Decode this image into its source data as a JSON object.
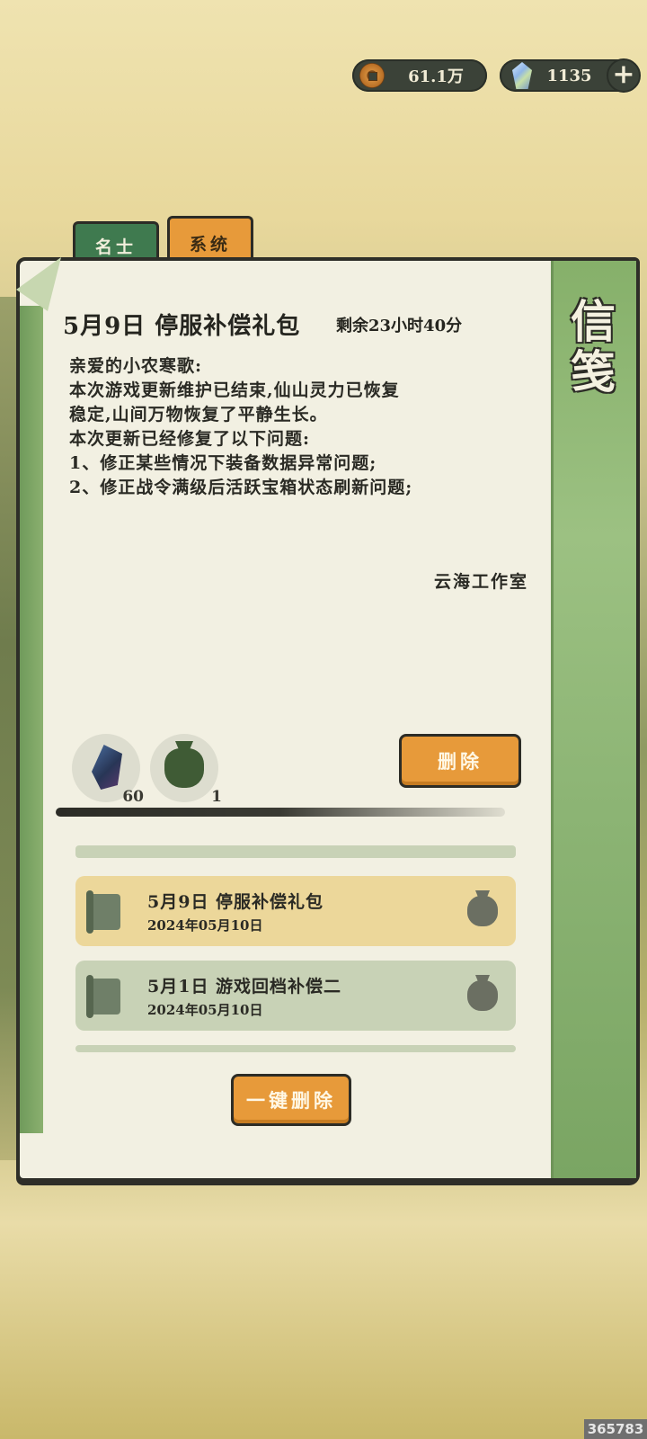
{
  "currency": {
    "coins": "61.1万",
    "gems": "1135",
    "plus": "+",
    "coin_icon": "copper-coin-icon",
    "gem_icon": "spirit-crystal-icon"
  },
  "tabs": [
    {
      "label": "名士",
      "active": false
    },
    {
      "label": "系统",
      "active": true
    }
  ],
  "panel": {
    "side_title": "信笺",
    "mail": {
      "title": "5月9日 停服补偿礼包",
      "remaining": "剩余23小时40分",
      "body": [
        "亲爱的小农寒歌:",
        "本次游戏更新维护已结束,仙山灵力已恢复",
        "稳定,山间万物恢复了平静生长。",
        "",
        "本次更新已经修复了以下问题:",
        "1、修正某些情况下装备数据异常问题;",
        "2、修正战令满级后活跃宝箱状态刷新问题;"
      ],
      "signature": "云海工作室"
    },
    "rewards": [
      {
        "icon": "stone-icon",
        "count": "60"
      },
      {
        "icon": "bag-icon",
        "count": "1"
      }
    ],
    "delete_label": "删除",
    "list": [
      {
        "title": "5月9日 停服补偿礼包",
        "date": "2024年05月10日",
        "active": true
      },
      {
        "title": "5月1日 游戏回档补偿二",
        "date": "2024年05月10日",
        "active": false
      }
    ],
    "delete_all_label": "一键删除"
  },
  "watermark": "365783",
  "colors": {
    "accent_orange": "#e79a3a",
    "tab_green": "#3f7a4f",
    "paper": "#f2f0e2",
    "side_green": "#8cb474",
    "ink": "#2c2c26"
  }
}
